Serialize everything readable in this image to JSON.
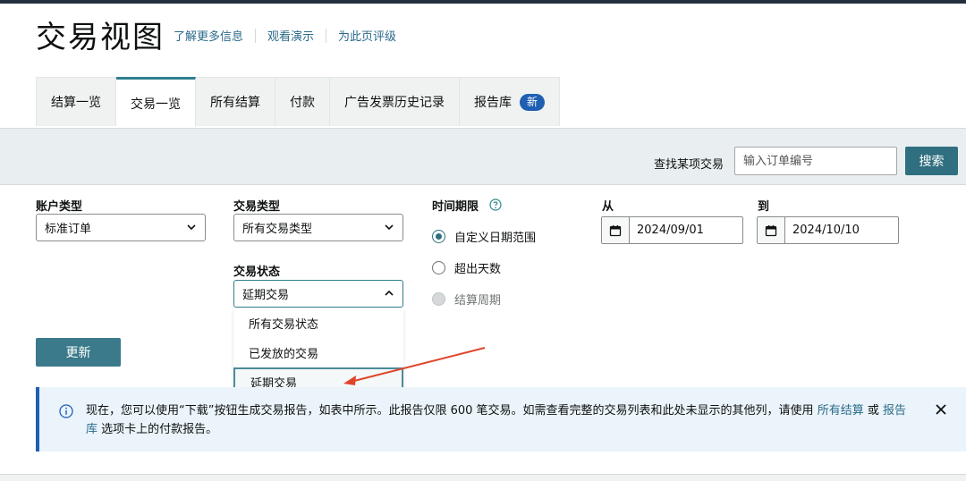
{
  "page": {
    "title": "交易视图",
    "links": [
      "了解更多信息",
      "观看演示",
      "为此页评级"
    ]
  },
  "tabs": [
    {
      "label": "结算一览"
    },
    {
      "label": "交易一览"
    },
    {
      "label": "所有结算"
    },
    {
      "label": "付款"
    },
    {
      "label": "广告发票历史记录"
    },
    {
      "label": "报告库",
      "badge": "新"
    }
  ],
  "search": {
    "label": "查找某项交易",
    "placeholder": "输入订单编号",
    "button": "搜索"
  },
  "filters": {
    "account_type": {
      "label": "账户类型",
      "value": "标准订单"
    },
    "transaction_type": {
      "label": "交易类型",
      "value": "所有交易类型"
    },
    "transaction_status": {
      "label": "交易状态",
      "value": "延期交易",
      "options": [
        "所有交易状态",
        "已发放的交易",
        "延期交易"
      ]
    },
    "period": {
      "label": "时间期限",
      "options": [
        "自定义日期范围",
        "超出天数",
        "结算周期"
      ]
    },
    "from": {
      "label": "从",
      "value": "2024/09/01"
    },
    "to": {
      "label": "到",
      "value": "2024/10/10"
    }
  },
  "update_button": "更新",
  "notice": {
    "text1": "现在，您可以使用“下载”按钮生成交易报告，如表中所示。此报告仅限 600 笔交易。如需查看完整的交易列表和此处未显示的其他列，请使用 ",
    "link1": "所有结算",
    "text2": " 或 ",
    "link2": "报告库",
    "text3": " 选项卡上的付款报告。"
  },
  "colors": {
    "accent": "#2f6f80",
    "link": "#2b6a8a",
    "badge": "#1f5fb2",
    "annotation_arrow": "#e0442b"
  }
}
